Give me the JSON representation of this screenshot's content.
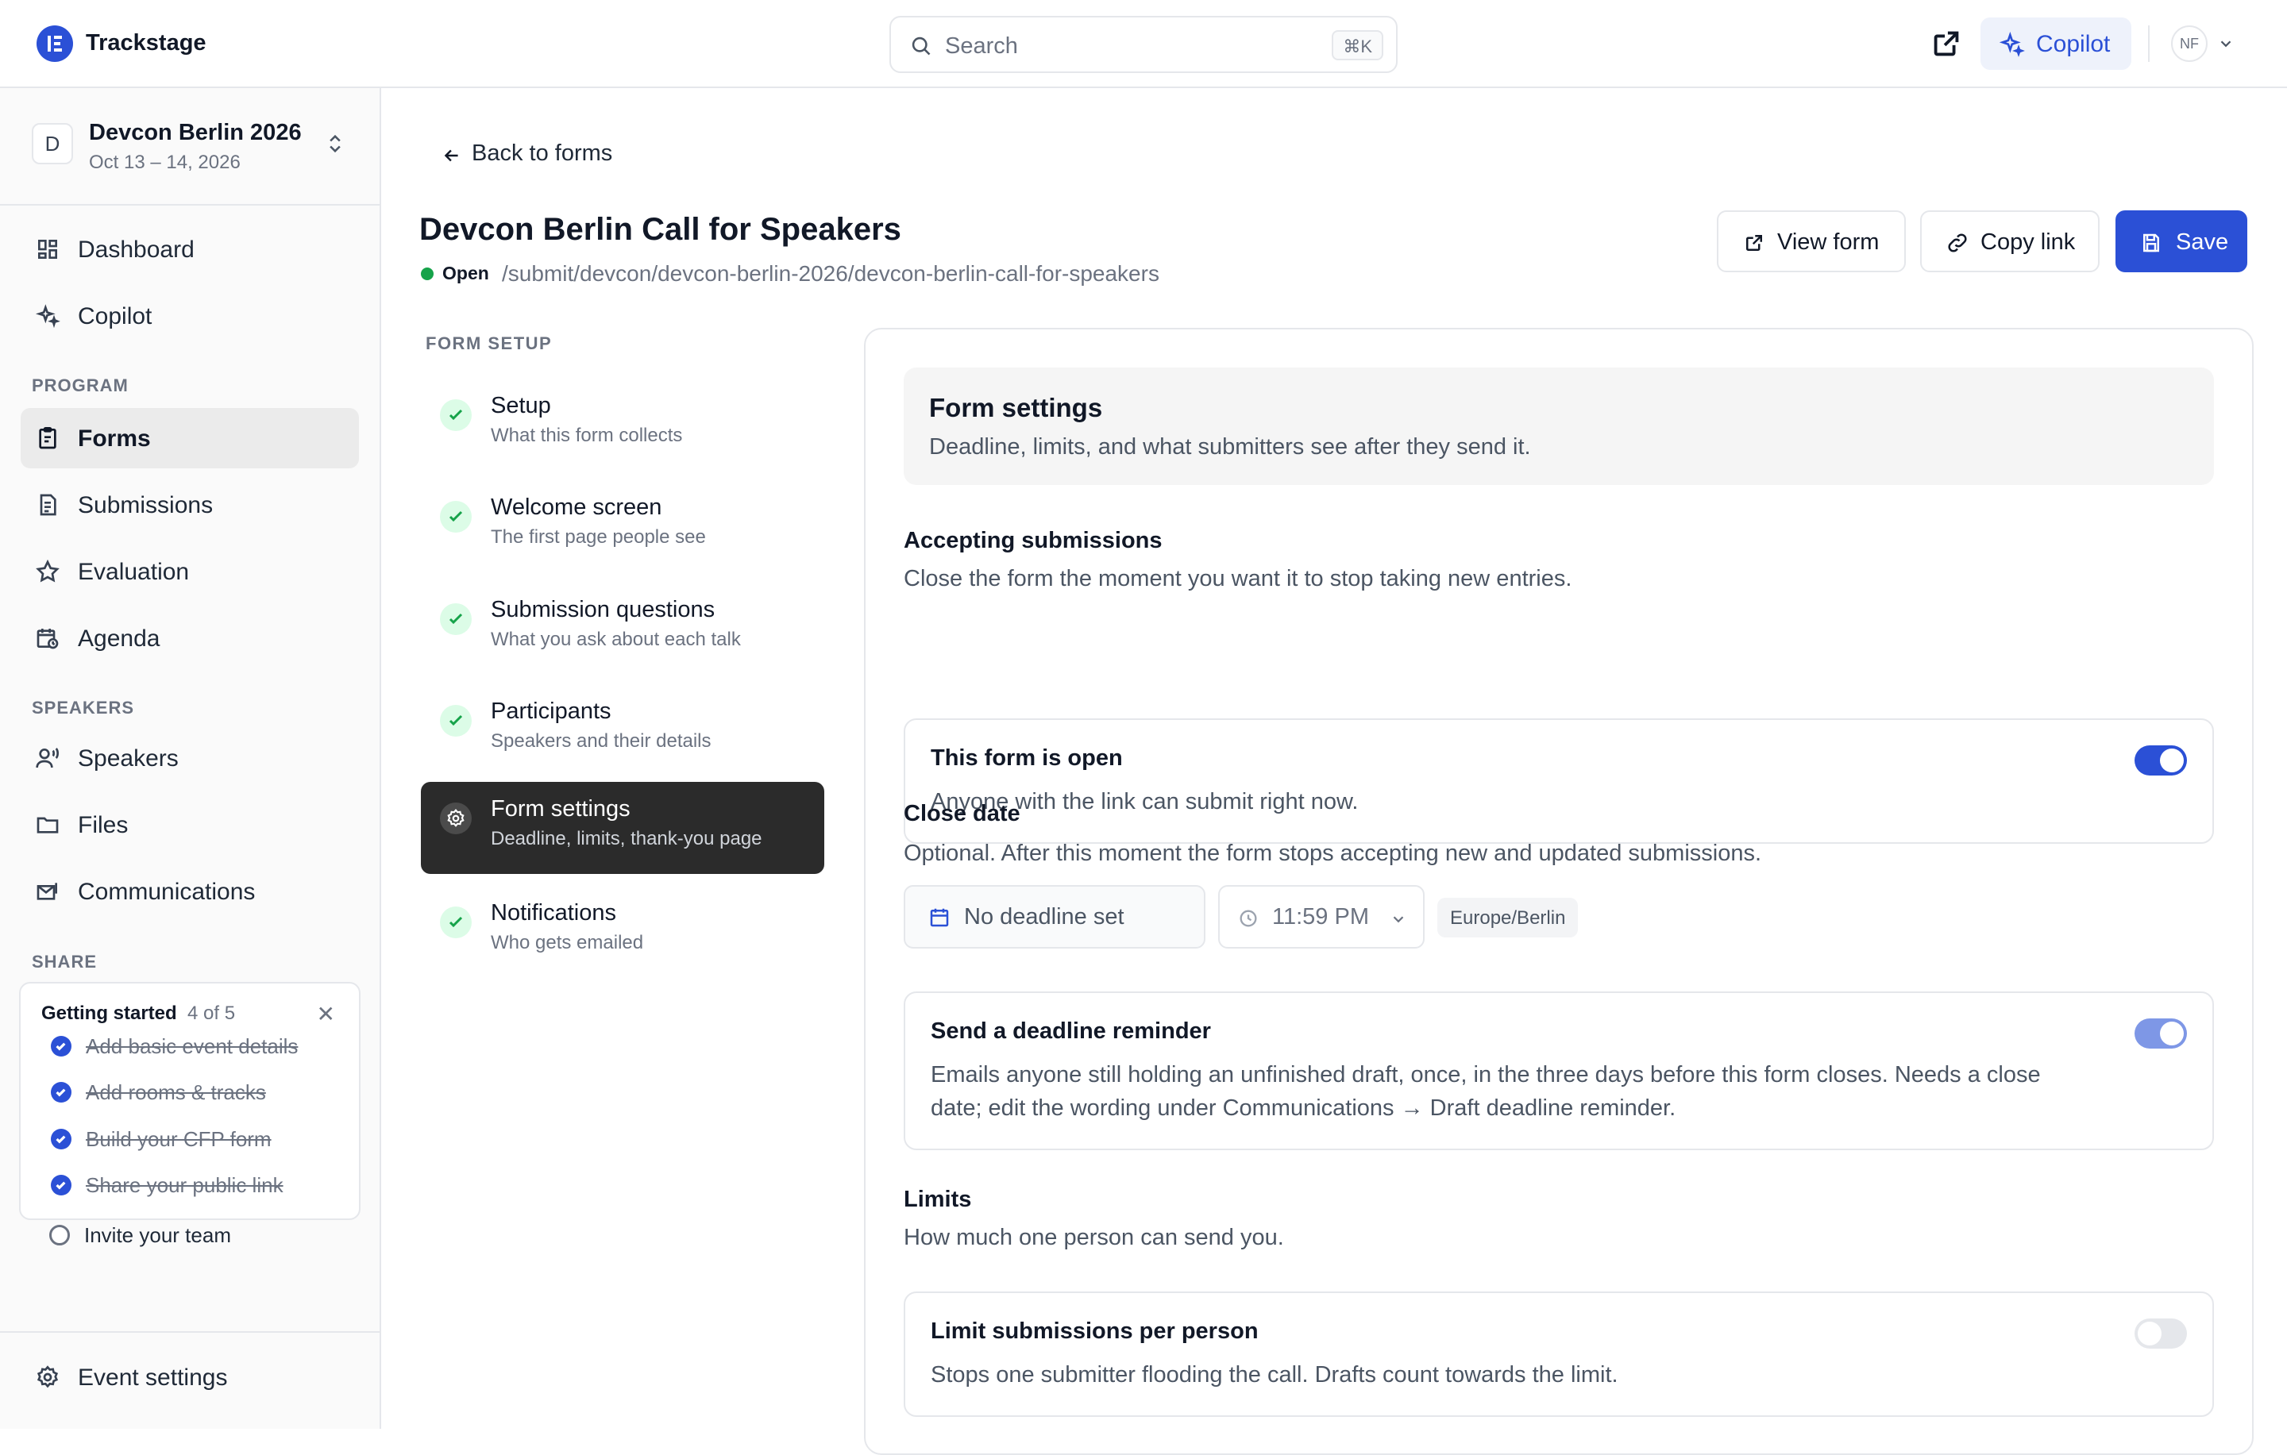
{
  "app": {
    "name": "Trackstage"
  },
  "search": {
    "placeholder": "Search",
    "shortcut": "⌘K"
  },
  "header": {
    "copilot_label": "Copilot",
    "user_initials": "NF"
  },
  "event": {
    "initial": "D",
    "name": "Devcon Berlin 2026",
    "dates": "Oct 13 – 14, 2026"
  },
  "sidebar": {
    "top_items": [
      {
        "label": "Dashboard",
        "icon": "dashboard-icon"
      },
      {
        "label": "Copilot",
        "icon": "sparkle-icon"
      }
    ],
    "program_title": "PROGRAM",
    "program_items": [
      {
        "label": "Forms",
        "icon": "clipboard-icon",
        "active": true
      },
      {
        "label": "Submissions",
        "icon": "document-icon"
      },
      {
        "label": "Evaluation",
        "icon": "star-icon"
      },
      {
        "label": "Agenda",
        "icon": "calendar-clock-icon"
      }
    ],
    "speakers_title": "SPEAKERS",
    "speakers_items": [
      {
        "label": "Speakers",
        "icon": "user-voice-icon"
      },
      {
        "label": "Files",
        "icon": "folder-icon"
      },
      {
        "label": "Communications",
        "icon": "mail-icon"
      }
    ],
    "share_title": "SHARE",
    "getting_started": {
      "title": "Getting started",
      "count": "4 of 5",
      "items": [
        {
          "label": "Add basic event details",
          "done": true
        },
        {
          "label": "Add rooms & tracks",
          "done": true
        },
        {
          "label": "Build your CFP form",
          "done": true
        },
        {
          "label": "Share your public link",
          "done": true
        },
        {
          "label": "Invite your team",
          "done": false
        }
      ]
    },
    "footer_label": "Event settings"
  },
  "page": {
    "back_label": "Back to forms",
    "title": "Devcon Berlin Call for Speakers",
    "status": "Open",
    "path": "/submit/devcon/devcon-berlin-2026/devcon-berlin-call-for-speakers",
    "view_form": "View form",
    "copy_link": "Copy link",
    "save": "Save"
  },
  "form_setup": {
    "title": "FORM SETUP",
    "steps": [
      {
        "name": "Setup",
        "desc": "What this form collects",
        "state": "done"
      },
      {
        "name": "Welcome screen",
        "desc": "The first page people see",
        "state": "done"
      },
      {
        "name": "Submission questions",
        "desc": "What you ask about each talk",
        "state": "done"
      },
      {
        "name": "Participants",
        "desc": "Speakers and their details",
        "state": "done"
      },
      {
        "name": "Form settings",
        "desc": "Deadline, limits, thank-you page",
        "state": "active"
      },
      {
        "name": "Notifications",
        "desc": "Who gets emailed",
        "state": "done"
      }
    ]
  },
  "settings": {
    "title": "Form settings",
    "subtitle": "Deadline, limits, and what submitters see after they send it.",
    "accepting": {
      "label": "Accepting submissions",
      "desc": "Close the form the moment you want it to stop taking new entries.",
      "card_title": "This form is open",
      "card_desc": "Anyone with the link can submit right now.",
      "enabled": true
    },
    "close_date": {
      "label": "Close date",
      "desc": "Optional. After this moment the form stops accepting new and updated submissions.",
      "date_value": "No deadline set",
      "time_value": "11:59 PM",
      "timezone": "Europe/Berlin"
    },
    "reminder": {
      "title": "Send a deadline reminder",
      "desc": "Emails anyone still holding an unfinished draft, once, in the three days before this form closes. Needs a close date; edit the wording under Communications → Draft deadline reminder.",
      "enabled": true
    },
    "limits": {
      "label": "Limits",
      "desc": "How much one person can send you.",
      "card_title": "Limit submissions per person",
      "card_desc": "Stops one submitter flooding the call. Drafts count towards the limit.",
      "enabled": false
    }
  },
  "colors": {
    "accent": "#2b50d6",
    "success": "#16a34a",
    "active_step": "#2b2b2b"
  }
}
